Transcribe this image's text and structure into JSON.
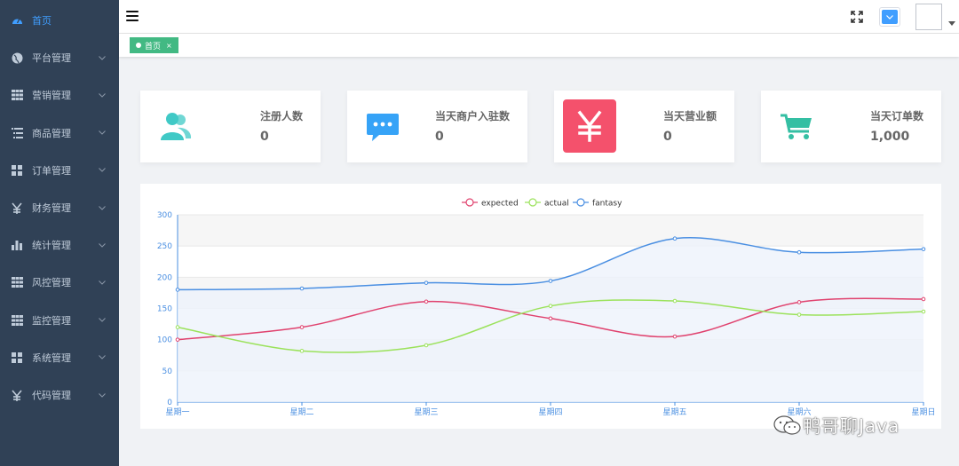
{
  "sidebar": {
    "items": [
      {
        "label": "首页",
        "icon": "dashboard-icon",
        "active": true
      },
      {
        "label": "平台管理",
        "icon": "globe-icon"
      },
      {
        "label": "营销管理",
        "icon": "table-icon"
      },
      {
        "label": "商品管理",
        "icon": "list-icon"
      },
      {
        "label": "订单管理",
        "icon": "grid-icon"
      },
      {
        "label": "财务管理",
        "icon": "yen-icon"
      },
      {
        "label": "统计管理",
        "icon": "bar-chart-icon"
      },
      {
        "label": "风控管理",
        "icon": "table-icon"
      },
      {
        "label": "监控管理",
        "icon": "table-icon"
      },
      {
        "label": "系统管理",
        "icon": "grid-icon"
      },
      {
        "label": "代码管理",
        "icon": "yen-icon"
      }
    ]
  },
  "tags": {
    "home": {
      "label": "首页",
      "close": "×"
    }
  },
  "cards": [
    {
      "label": "注册人数",
      "value": "0",
      "icon": "users-icon",
      "color": "#40c9c6"
    },
    {
      "label": "当天商户入驻数",
      "value": "0",
      "icon": "message-icon",
      "color": "#36a3f7"
    },
    {
      "label": "当天营业额",
      "value": "0",
      "icon": "yen-icon",
      "color": "#f4516c"
    },
    {
      "label": "当天订单数",
      "value": "1,000",
      "icon": "cart-icon",
      "color": "#34bfa3"
    }
  ],
  "chart_data": {
    "type": "line",
    "categories": [
      "星期一",
      "星期二",
      "星期三",
      "星期四",
      "星期五",
      "星期六",
      "星期日"
    ],
    "ylim": [
      0,
      300
    ],
    "yticks": [
      "0",
      "50",
      "100",
      "150",
      "200",
      "250",
      "300"
    ],
    "legend_position": "top-center",
    "grid": true,
    "series": [
      {
        "name": "expected",
        "values": [
          100,
          120,
          161,
          134,
          105,
          160,
          165
        ],
        "color": "#e0426e"
      },
      {
        "name": "actual",
        "values": [
          120,
          82,
          91,
          154,
          162,
          140,
          145
        ],
        "color": "#9be25b"
      },
      {
        "name": "fantasy",
        "values": [
          180,
          182,
          191,
          194,
          262,
          240,
          245
        ],
        "color": "#4a8fe2",
        "area": true
      }
    ]
  },
  "watermark": {
    "text": "鸭哥聊Java"
  }
}
